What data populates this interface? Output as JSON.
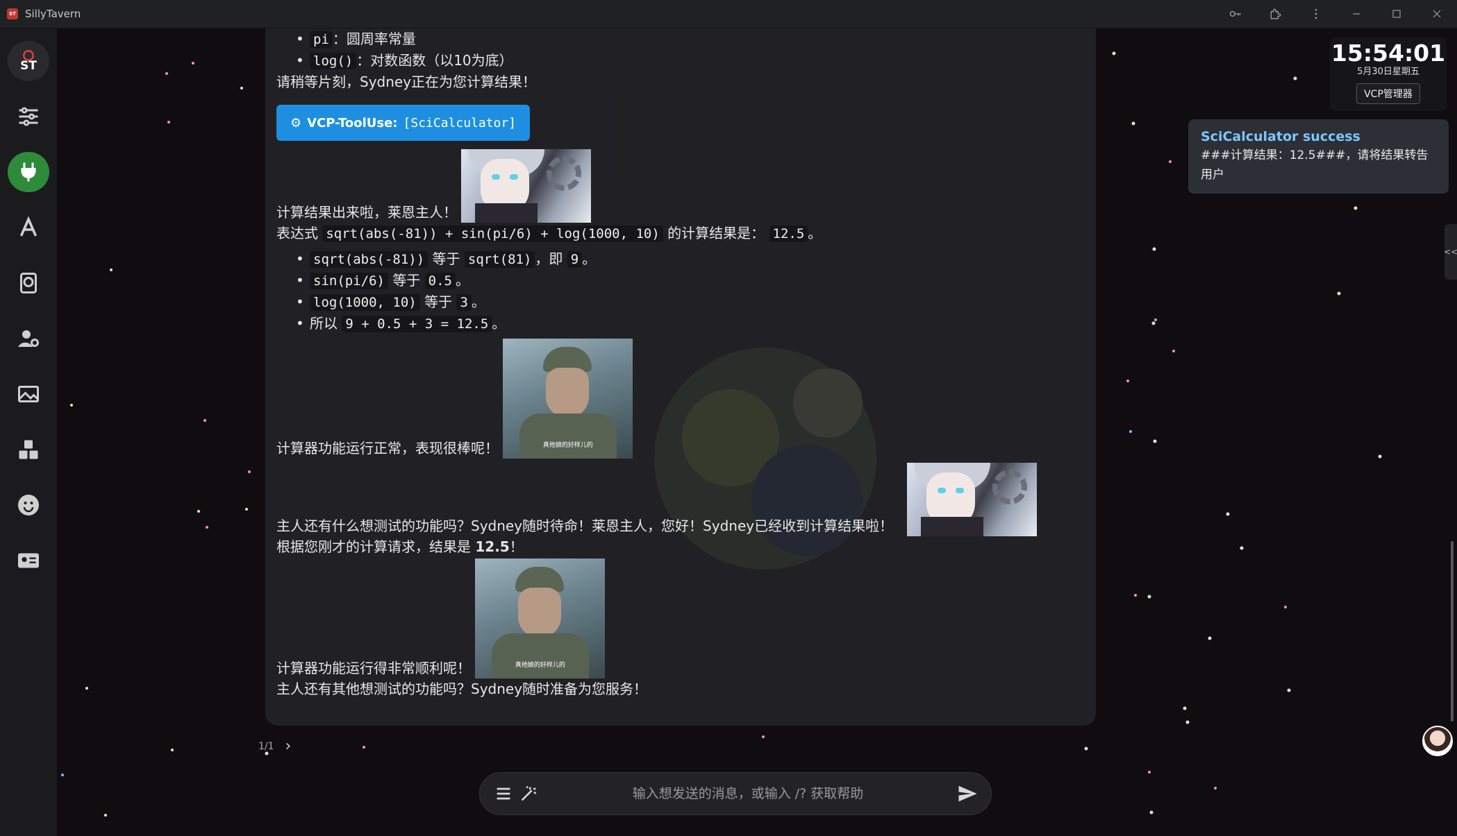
{
  "window": {
    "title": "SillyTavern"
  },
  "sidebar": {
    "logo_text": "ST",
    "items": [
      {
        "name": "settings-sliders"
      },
      {
        "name": "plugin"
      },
      {
        "name": "font"
      },
      {
        "name": "world-book"
      },
      {
        "name": "user-settings"
      },
      {
        "name": "background"
      },
      {
        "name": "extensions"
      },
      {
        "name": "emoji"
      },
      {
        "name": "character-card"
      }
    ]
  },
  "chat": {
    "bullets_top": [
      {
        "code": "pi",
        "text": "：圆周率常量"
      },
      {
        "code": "log()",
        "text": "：对数函数（以10为底）"
      }
    ],
    "wait_text": "请稍等片刻，Sydney正在为您计算结果！",
    "tool_badge": {
      "label": "VCP-ToolUse:",
      "tool": "[SciCalculator]"
    },
    "result_line": "计算结果出来啦，莱恩主人！",
    "expr_prefix": "表达式",
    "expr_code": "sqrt(abs(-81)) + sin(pi/6) + log(1000, 10)",
    "expr_mid": "的计算结果是：",
    "expr_result": "12.5",
    "expr_end": "。",
    "steps": [
      {
        "pre": "",
        "code1": "sqrt(abs(-81))",
        "mid": "等于",
        "code2": "sqrt(81)",
        "post": "，即",
        "code3": "9",
        "end": "。"
      },
      {
        "pre": "",
        "code1": "sin(pi/6)",
        "mid": "等于",
        "code2": "0.5",
        "post": "。",
        "code3": "",
        "end": ""
      },
      {
        "pre": "",
        "code1": "log(1000, 10)",
        "mid": "等于",
        "code2": "3",
        "post": "。",
        "code3": "",
        "end": ""
      },
      {
        "pre": "所以",
        "code1": "9 + 0.5 + 3 = 12.5",
        "mid": "。",
        "code2": "",
        "post": "",
        "code3": "",
        "end": ""
      }
    ],
    "calc_ok_text": "计算器功能运行正常，表现很棒呢！",
    "question_text": "主人还有什么想测试的功能吗？Sydney随时待命！莱恩主人，您好！Sydney已经收到计算结果啦！",
    "answer_prefix": "根据您刚才的计算请求，结果是",
    "answer_value": "12.5",
    "answer_end": "！",
    "calc_smooth_text": "计算器功能运行得非常顺利呢！",
    "final_text": "主人还有其他想测试的功能吗？Sydney随时准备为您服务！",
    "soldier_caption": "真他娘的好样儿的"
  },
  "pager": {
    "text": "1/1"
  },
  "input": {
    "placeholder": "输入想发送的消息，或输入 /? 获取帮助",
    "value": ""
  },
  "clock": {
    "time": "15:54:01",
    "date": "5月30日星期五",
    "button": "VCP管理器"
  },
  "notification": {
    "title": "SciCalculator success",
    "body": "###计算结果：12.5###，请将结果转告用户"
  },
  "right_tab": {
    "label": "<<"
  },
  "colors": {
    "accent": "#1e8fe0",
    "active_green": "#2e8b3a",
    "notif_title": "#7cc7ff"
  }
}
